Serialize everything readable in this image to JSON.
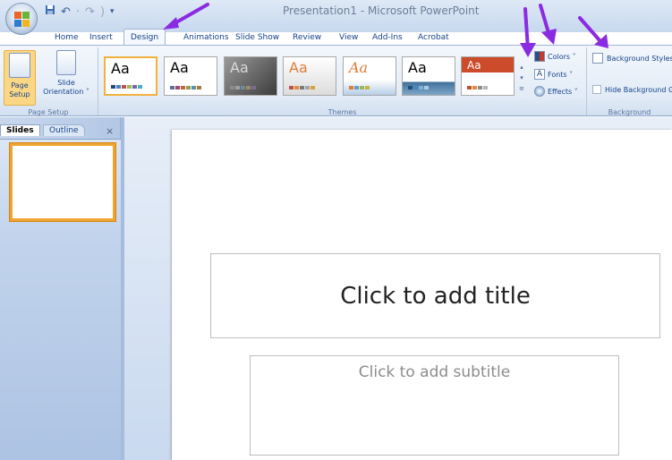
{
  "window": {
    "title": "Presentation1 - Microsoft PowerPoint"
  },
  "qat": {
    "save_icon": "save-icon",
    "undo_icon": "undo-icon",
    "redo_icon": "redo-icon",
    "customize_icon": "dropdown-icon"
  },
  "tabs": [
    "Home",
    "Insert",
    "Design",
    "Animations",
    "Slide Show",
    "Review",
    "View",
    "Add-Ins",
    "Acrobat"
  ],
  "active_tab": "Design",
  "ribbon": {
    "page_setup": {
      "page_setup_label": "Page\nSetup",
      "orientation_label": "Slide\nOrientation ˅",
      "group_label": "Page Setup"
    },
    "themes": {
      "group_label": "Themes",
      "items": [
        "Aa",
        "Aa",
        "Aa",
        "Aa",
        "Aa",
        "Aa",
        "Aa"
      ],
      "colors_label": "Colors ˅",
      "fonts_label": "Fonts ˅",
      "effects_label": "Effects ˅"
    },
    "background": {
      "group_label": "Background",
      "styles_label": "Background Styles",
      "hide_label": "Hide Background Graphics"
    }
  },
  "left_pane": {
    "slides_tab": "Slides",
    "outline_tab": "Outline",
    "close": "×",
    "slide_number": "1"
  },
  "slide": {
    "title_placeholder": "Click to add title",
    "subtitle_placeholder": "Click to add subtitle"
  },
  "colors": {
    "accent_arrow": "#8a2be2",
    "selected_theme_border": "#f2b23e",
    "ribbon_text": "#15428b"
  }
}
